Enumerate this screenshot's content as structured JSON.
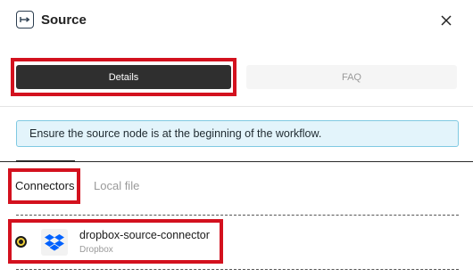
{
  "header": {
    "title": "Source",
    "source_icon": "source-node-icon",
    "close_icon": "close-icon"
  },
  "tabs": {
    "details": "Details",
    "faq": "FAQ",
    "active": "details"
  },
  "info": {
    "message": "Ensure the source node is at the beginning of the workflow."
  },
  "source_tabs": {
    "connectors": "Connectors",
    "local_file": "Local file",
    "active": "connectors"
  },
  "connectors": [
    {
      "name": "dropbox-source-connector",
      "type": "Dropbox",
      "icon": "dropbox-icon",
      "selected": true
    }
  ],
  "colors": {
    "highlight": "#d3111e",
    "active_tab_bg": "#2f2f2f",
    "info_bg": "#e3f4fb",
    "info_border": "#7fc9e2",
    "dropbox_blue": "#0061fe",
    "radio_fill": "#f0d23a"
  }
}
